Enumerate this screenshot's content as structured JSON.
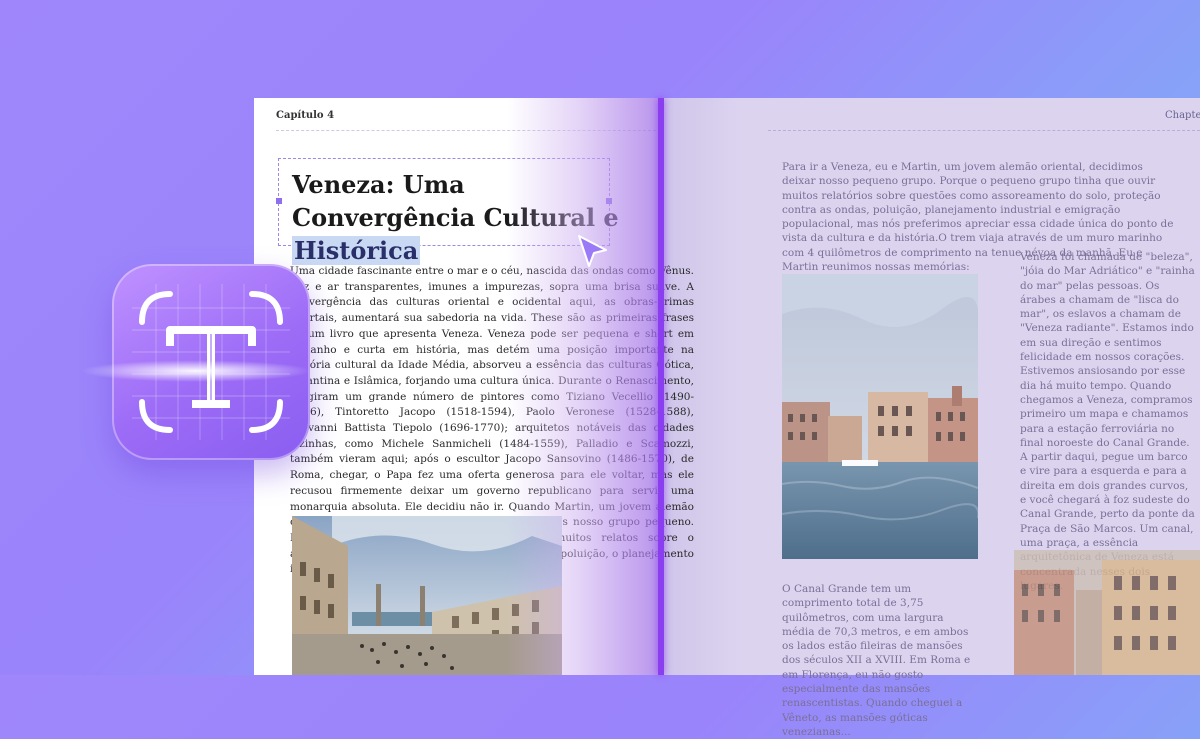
{
  "left_page": {
    "chapter": "Capítulo 4",
    "title_part1": "Veneza: Uma Convergência Cultural e ",
    "title_highlight": "Histórica",
    "body": "Uma cidade fascinante entre o mar e o céu, nascida das ondas como Vênus. Luz e ar transparentes, imunes a impurezas, sopra uma brisa suave. A convergência das culturas oriental e ocidental aqui, as obras-primas imortais, aumentará sua sabedoria na vida. These são as primeiras frases de um livro que apresenta Veneza. Veneza pode ser pequena e short em tamanho e curta em história, mas detém uma posição importante na história cultural da Idade Média, absorveu a essência das culturas Gótica, Bizantina e Islâmica, forjando uma cultura única. Durante o Renascimento, surgiram um grande número de pintores como Tiziano Vecellio (1490-1576), Tintoretto Jacopo (1518-1594), Paolo Veronese (1528-1588), Giovanni Battista Tiepolo (1696-1770); arquitetos notáveis das cidades vizinhas, como Michele Sanmicheli (1484-1559), Palladio e Scamozzi, também vieram aqui; após o escultor Jacopo Sansovino (1486-1570), de Roma, chegar, o Papa fez uma oferta generosa para ele voltar, mas ele recusou firmemente deixar um governo republicano para servir uma monarquia absoluta. Ele decidiu não ir. Quando Martin, um jovem alemão oriental, e eu decidimos ir para Veneza, deixamos nosso grupo pequeno. Porque o grupo pequeno tinha que ouvir muitos relatos sobre o assoreamento do solo, a defesa contra as ondas, a poluição, o planejamento industrial e a emigração populacional, e nós..."
  },
  "right_page": {
    "chapter": "Chapter",
    "body_top": "Para ir a Veneza, eu e Martin, um jovem alemão oriental, decidimos deixar nosso pequeno grupo. Porque o pequeno grupo tinha que ouvir muitos relatórios sobre questões como assoreamento do solo, proteção contra as ondas, poluição, planejamento industrial e emigração populacional, mas nós preferimos apreciar essa cidade única do ponto de vista da cultura e da história.O trem viaja através de um muro marinho com 4 quilômetros de comprimento na tenue névoa da manhã. Eu e Martin reunimos nossas memórias:",
    "body_side": "Veneza foi chamada de \"beleza\", \"jóia do Mar Adriático\" e \"rainha do mar\" pelas pessoas. Os árabes a chamam de \"lisca do mar\", os eslavos a chamam de \"Veneza radiante\". Estamos indo em sua direção e sentimos felicidade em nossos corações. Estivemos ansiosando por esse dia há muito tempo. Quando chegamos a Veneza, compramos primeiro um mapa e chamamos para a estação ferroviária no final noroeste do Canal Grande. A partir daqui, pegue um barco e vire para a esquerda e para a direita em dois grandes curvos, e você chegará à foz sudeste do Canal Grande, perto da ponte da Praça de São Marcos. Um canal, uma praça, a essência arquitetônica de Veneza está concentrada nesses dois lugares.",
    "body_bottom": "O Canal Grande tem um comprimento total de 3,75 quilômetros, com uma largura média de 70,3 metros, e em ambos os lados estão fileiras de mansões dos séculos XII a XVIII. Em Roma e em Florença, eu não gosto especialmente das mansões renascentistas. Quando cheguei a Vêneto, as mansões góticas venezianas..."
  },
  "icons": {
    "app": "text-recognition-icon",
    "cursor": "cursor-arrow-icon"
  },
  "colors": {
    "accent": "#8b3df0",
    "background_top": "#9f86fb",
    "background_bottom": "#7fb0f6",
    "highlight": "#c9d9f3"
  }
}
